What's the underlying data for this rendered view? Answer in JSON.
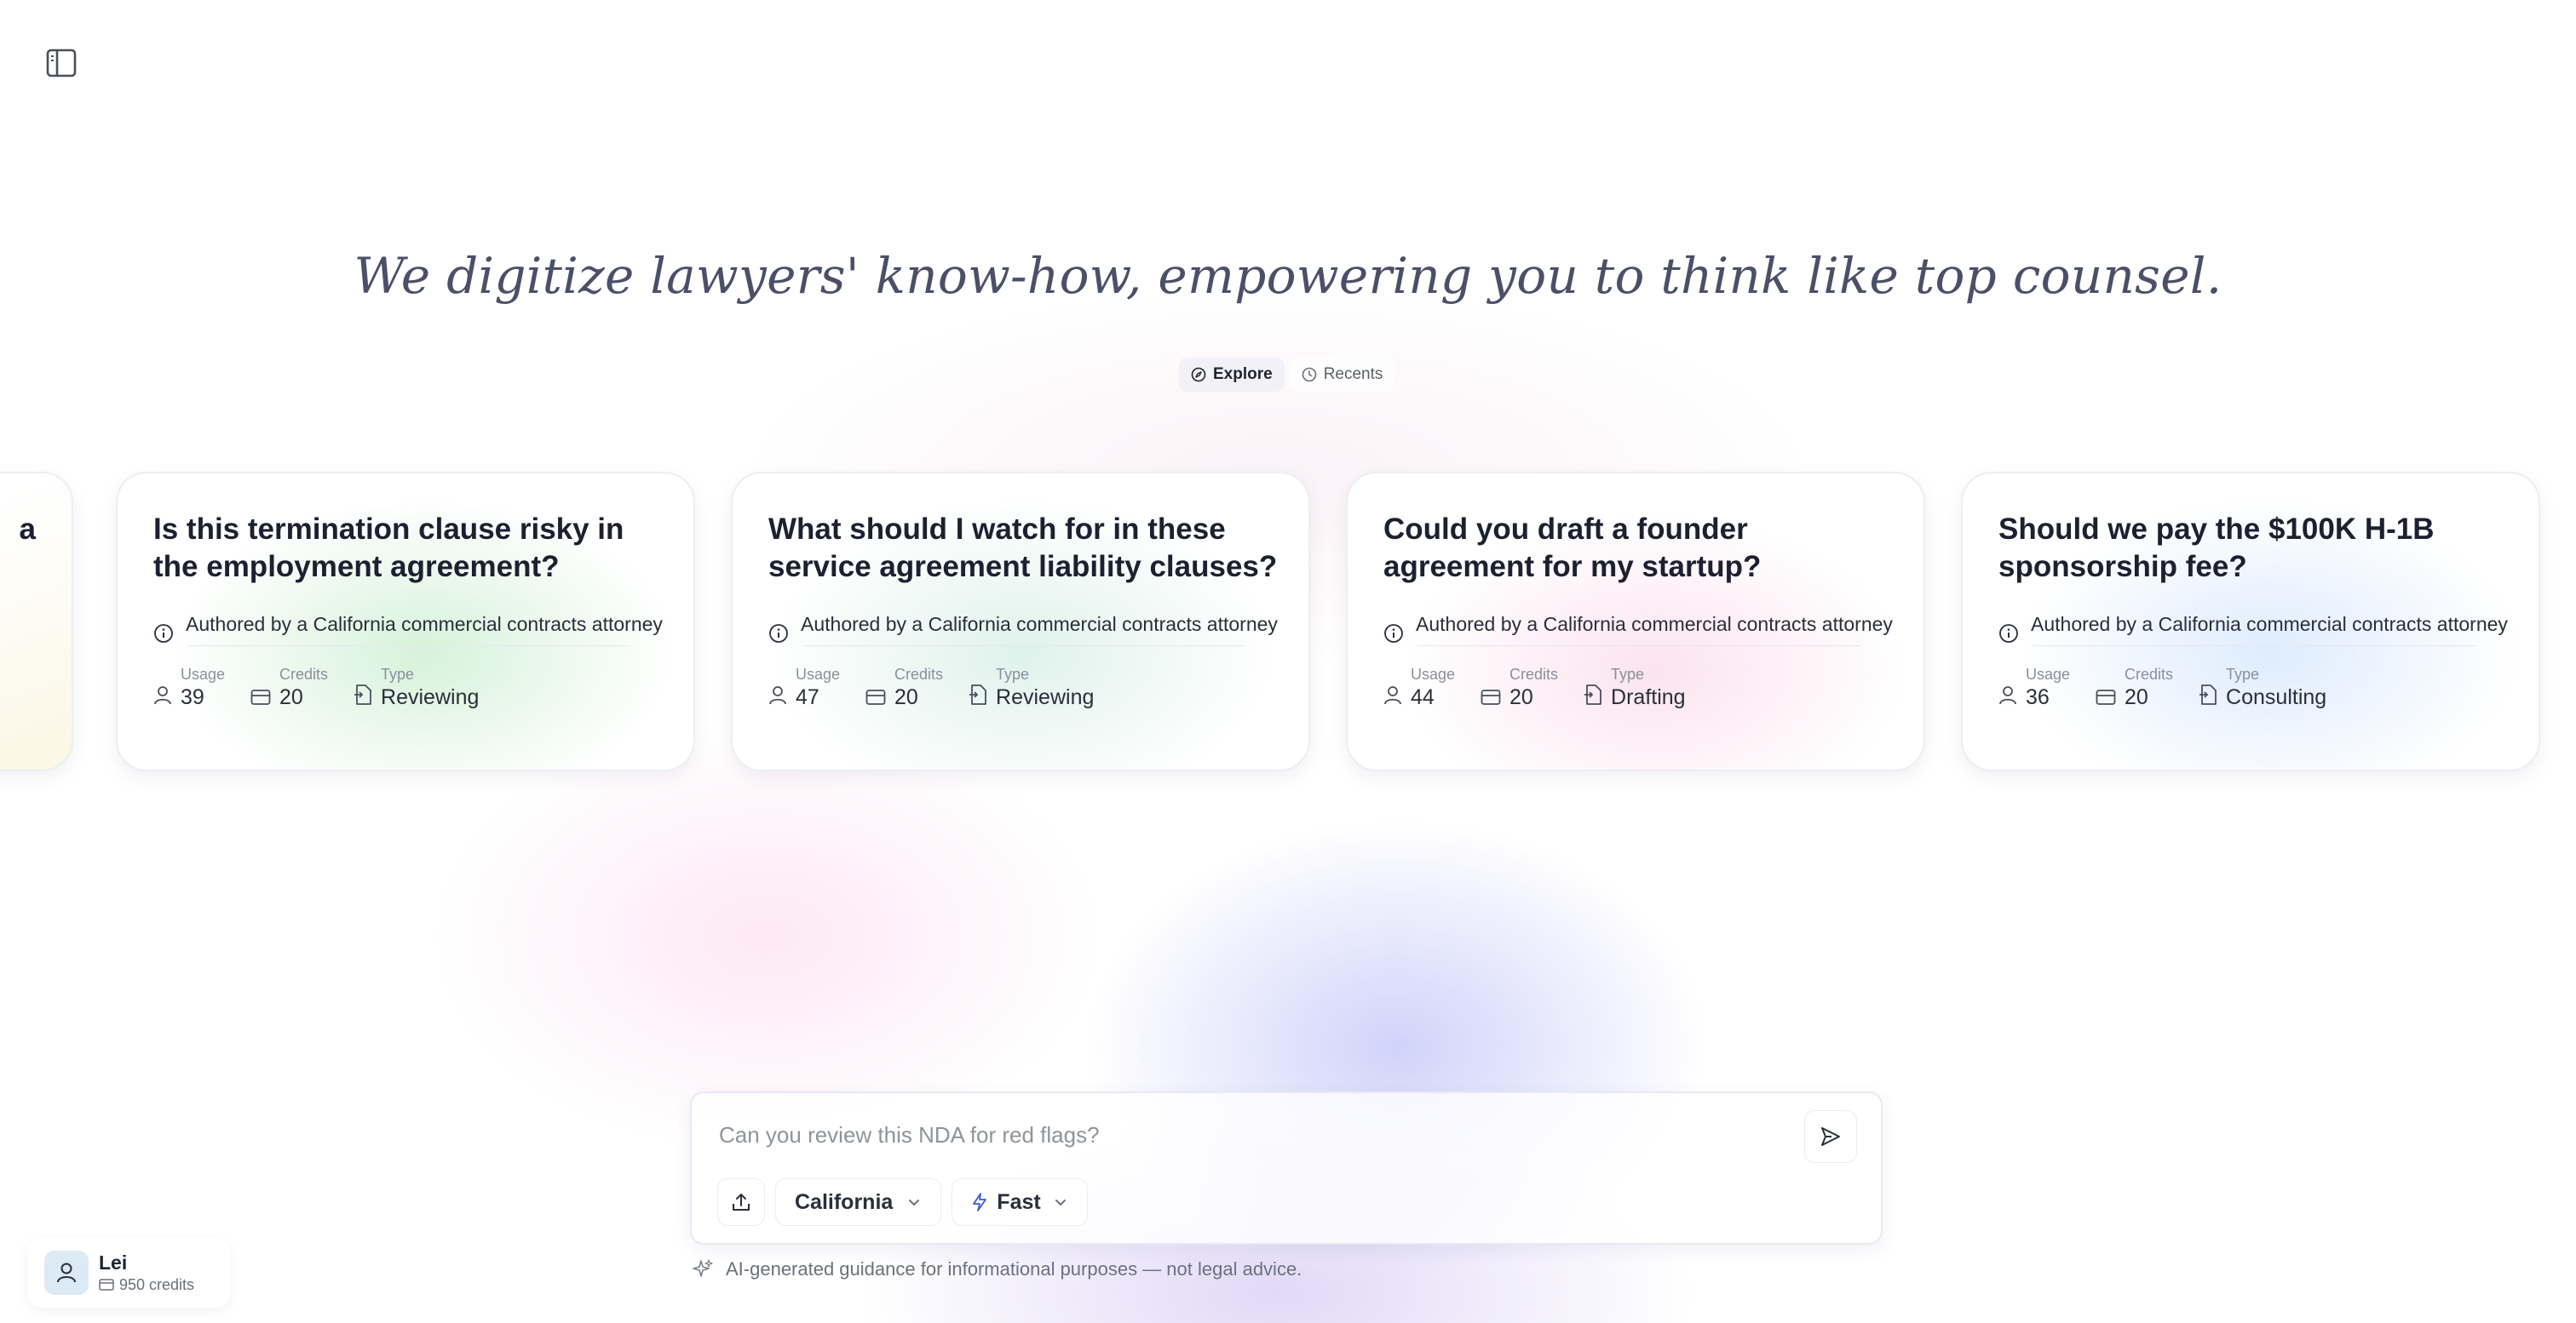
{
  "headline": "We digitize lawyers' know-how, empowering you to think like top counsel.",
  "tabs": [
    {
      "label": "Explore",
      "icon": "compass-icon",
      "active": true
    },
    {
      "label": "Recents",
      "icon": "clock-icon",
      "active": false
    }
  ],
  "cards": [
    {
      "title": "a",
      "author": "",
      "usage_label": "",
      "usage": "",
      "credits_label": "",
      "credits": "",
      "type_label": "",
      "type": ""
    },
    {
      "title": "Is this termination clause risky in the employment agreement?",
      "author": "Authored by a California commercial contracts attorney",
      "usage_label": "Usage",
      "usage": "39",
      "credits_label": "Credits",
      "credits": "20",
      "type_label": "Type",
      "type": "Reviewing"
    },
    {
      "title": "What should I watch for in these service agreement liability clauses?",
      "author": "Authored by a California commercial contracts attorney",
      "usage_label": "Usage",
      "usage": "47",
      "credits_label": "Credits",
      "credits": "20",
      "type_label": "Type",
      "type": "Reviewing"
    },
    {
      "title": "Could you draft a founder agreement for my startup?",
      "author": "Authored by a California commercial contracts attorney",
      "usage_label": "Usage",
      "usage": "44",
      "credits_label": "Credits",
      "credits": "20",
      "type_label": "Type",
      "type": "Drafting"
    },
    {
      "title": "Should we pay the $100K H-1B sponsorship fee?",
      "author": "Authored by a California commercial contracts attorney",
      "usage_label": "Usage",
      "usage": "36",
      "credits_label": "Credits",
      "credits": "20",
      "type_label": "Type",
      "type": "Consulting"
    }
  ],
  "composer": {
    "placeholder": "Can you review this NDA for red flags?",
    "jurisdiction": "California",
    "mode": "Fast"
  },
  "disclaimer": "AI-generated guidance for informational purposes — not legal advice.",
  "user": {
    "name": "Lei",
    "credits": "950 credits"
  },
  "colors": {
    "text_primary": "#1f2330",
    "text_muted": "#8a8f9e",
    "headline": "#4a5068"
  }
}
